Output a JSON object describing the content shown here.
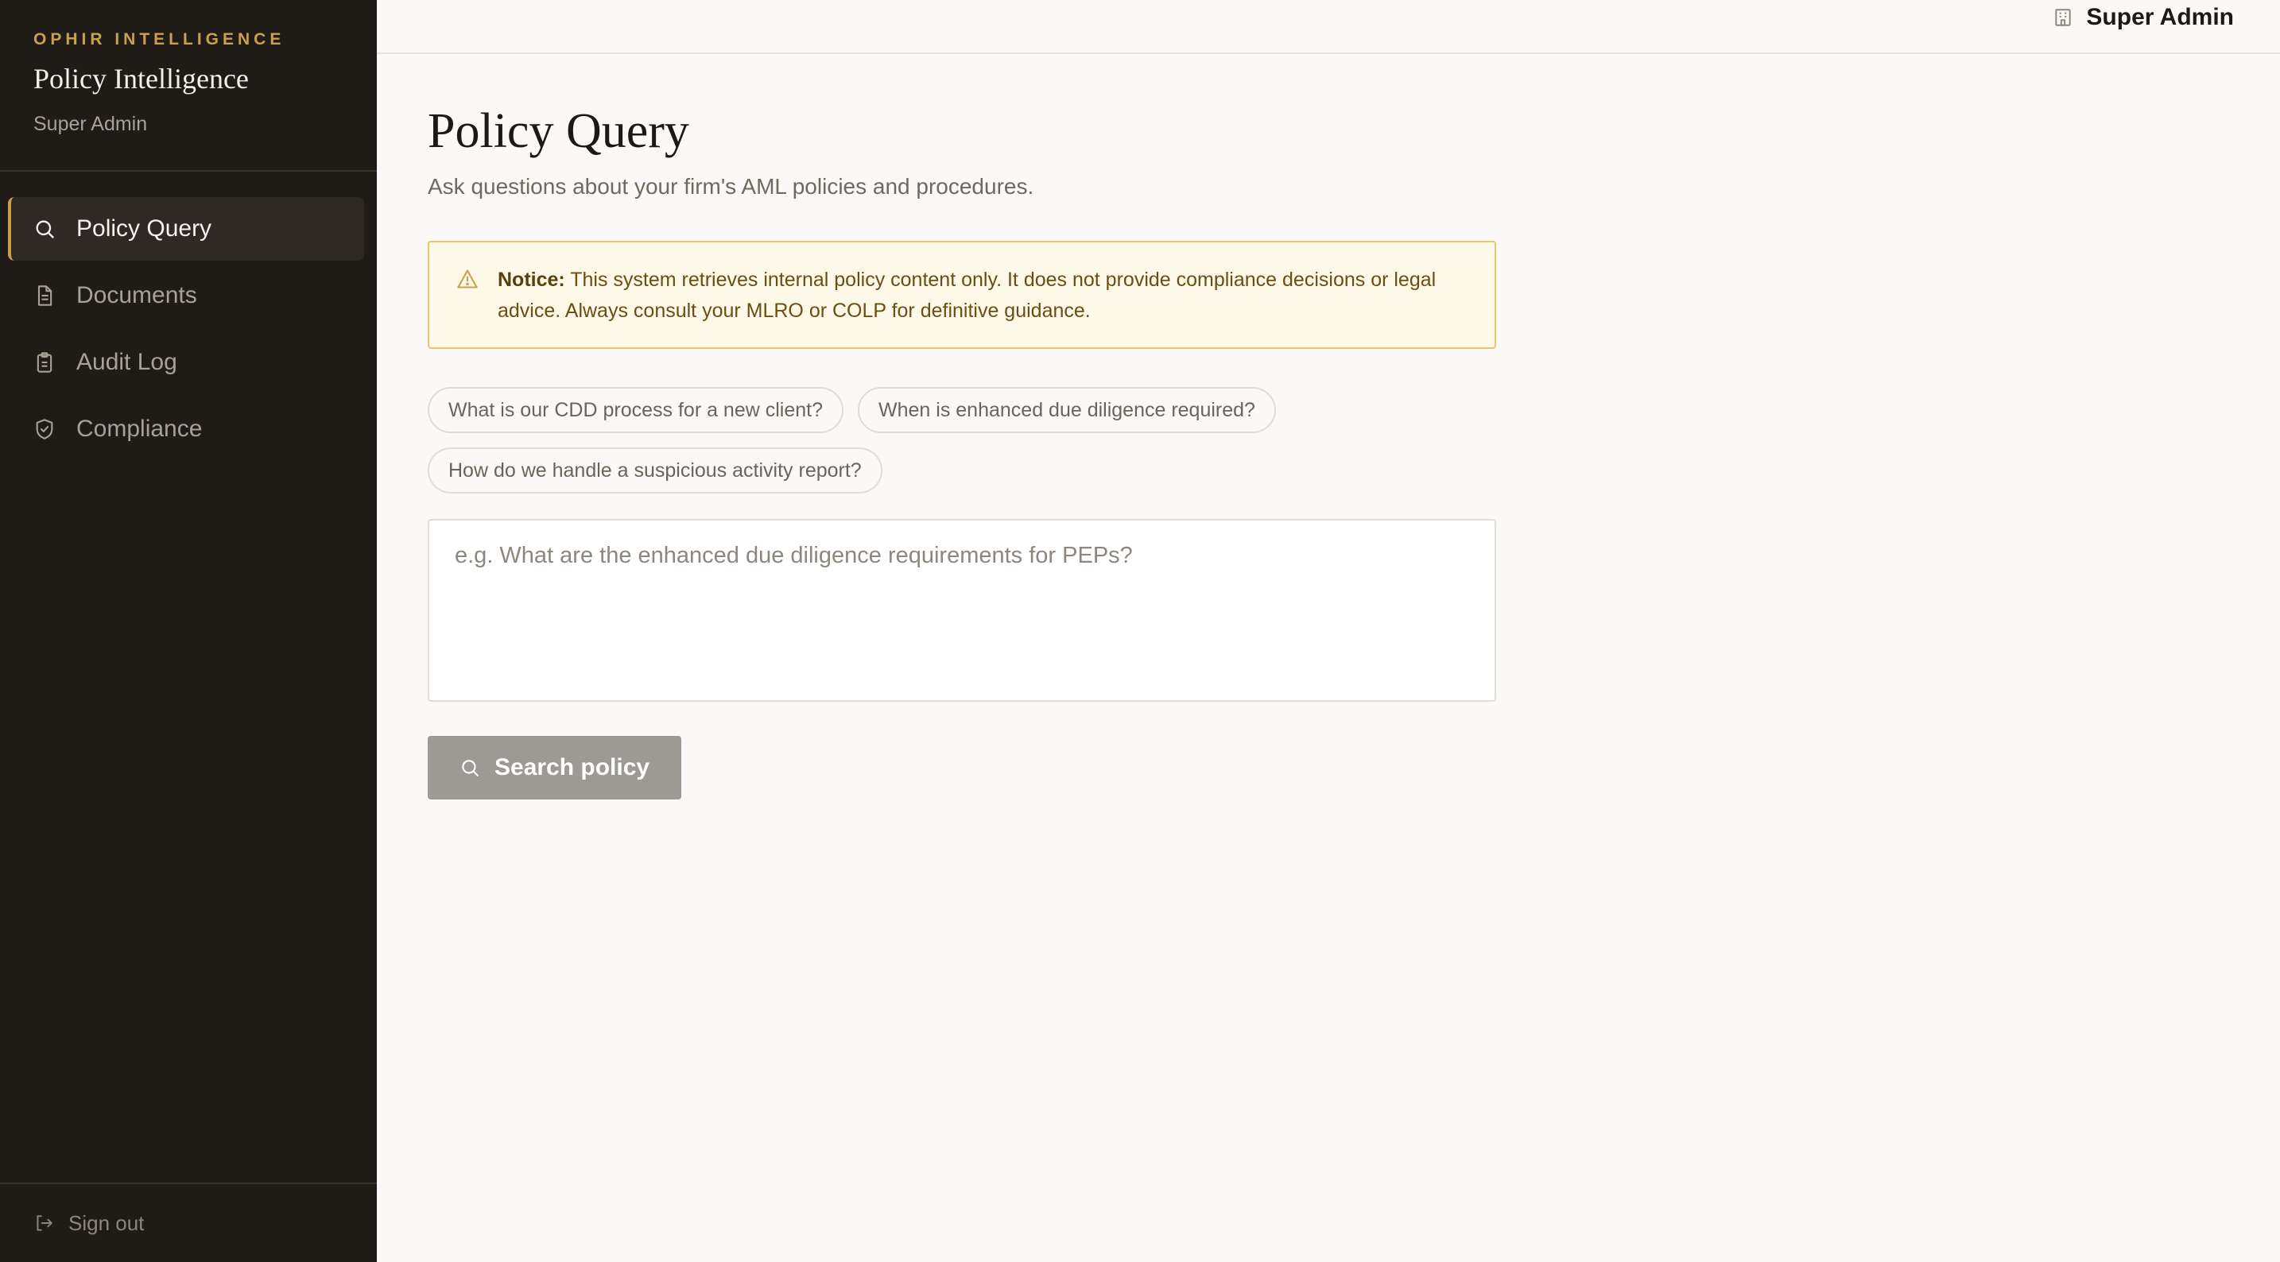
{
  "sidebar": {
    "kicker": "OPHIR INTELLIGENCE",
    "title": "Policy Intelligence",
    "role": "Super Admin",
    "items": [
      {
        "label": "Policy Query",
        "icon": "search-icon",
        "active": true
      },
      {
        "label": "Documents",
        "icon": "document-icon",
        "active": false
      },
      {
        "label": "Audit Log",
        "icon": "clipboard-icon",
        "active": false
      },
      {
        "label": "Compliance",
        "icon": "shield-check-icon",
        "active": false
      }
    ],
    "signout_label": "Sign out"
  },
  "topbar": {
    "user_name": "Super Admin",
    "icon": "building-icon"
  },
  "main": {
    "title": "Policy Query",
    "subtitle": "Ask questions about your firm's AML policies and procedures.",
    "notice": {
      "label": "Notice:",
      "text": "This system retrieves internal policy content only. It does not provide compliance decisions or legal advice. Always consult your MLRO or COLP for definitive guidance.",
      "icon": "warning-icon"
    },
    "suggestions": [
      "What is our CDD process for a new client?",
      "When is enhanced due diligence required?",
      "How do we handle a suspicious activity report?"
    ],
    "query": {
      "value": "",
      "placeholder": "e.g. What are the enhanced due diligence requirements for PEPs?"
    },
    "search_button_label": "Search policy"
  },
  "colors": {
    "sidebar_bg": "#1f1b17",
    "accent": "#c9a14a",
    "notice_bg": "#fdf8e7",
    "notice_border": "#e6c86a",
    "button_disabled": "#9d9994"
  }
}
